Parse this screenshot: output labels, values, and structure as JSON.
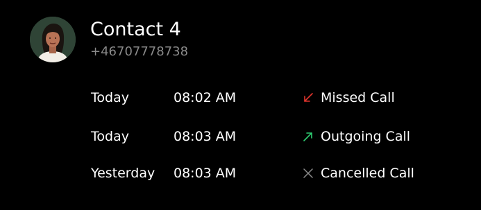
{
  "contact": {
    "name": "Contact 4",
    "number": "+46707778738",
    "avatar_icon": "person-avatar-icon"
  },
  "calls": [
    {
      "day": "Today",
      "time": "08:02 AM",
      "type": "Missed Call",
      "icon": "missed-call-arrow-icon",
      "icon_color": "#e0342c"
    },
    {
      "day": "Today",
      "time": "08:03 AM",
      "type": "Outgoing Call",
      "icon": "outgoing-call-arrow-icon",
      "icon_color": "#2ecc71"
    },
    {
      "day": "Yesterday",
      "time": "08:03 AM",
      "type": "Cancelled Call",
      "icon": "cancelled-call-x-icon",
      "icon_color": "#8a8a8a"
    }
  ],
  "colors": {
    "background": "#000000",
    "text_primary": "#ffffff",
    "text_secondary": "#8a8a8a"
  }
}
